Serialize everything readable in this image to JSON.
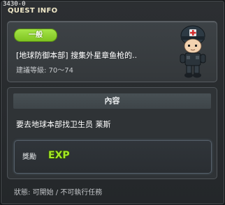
{
  "window": {
    "quest_id": "3430-0",
    "title": "QUEST INFO"
  },
  "quest": {
    "category_badge": "一般",
    "name": "[地球防御本部] 搜集外星章鱼枪的..",
    "level_label": "建議等級",
    "level_sep": ":",
    "level_range": "70～74",
    "npc_icon": "soldier-npc-icon"
  },
  "content": {
    "header": "內容",
    "description": "要去地球本部找卫生员  莱斯",
    "reward": {
      "label": "獎勵",
      "exp_icon": "exp-icon",
      "exp_text": "EXP"
    }
  },
  "status": {
    "text": "狀態: 可開始 / 不可執行任務"
  },
  "colors": {
    "badge_green": "#8fd22f",
    "exp_green": "#a4e825",
    "window_bg": "#2a2d30"
  }
}
